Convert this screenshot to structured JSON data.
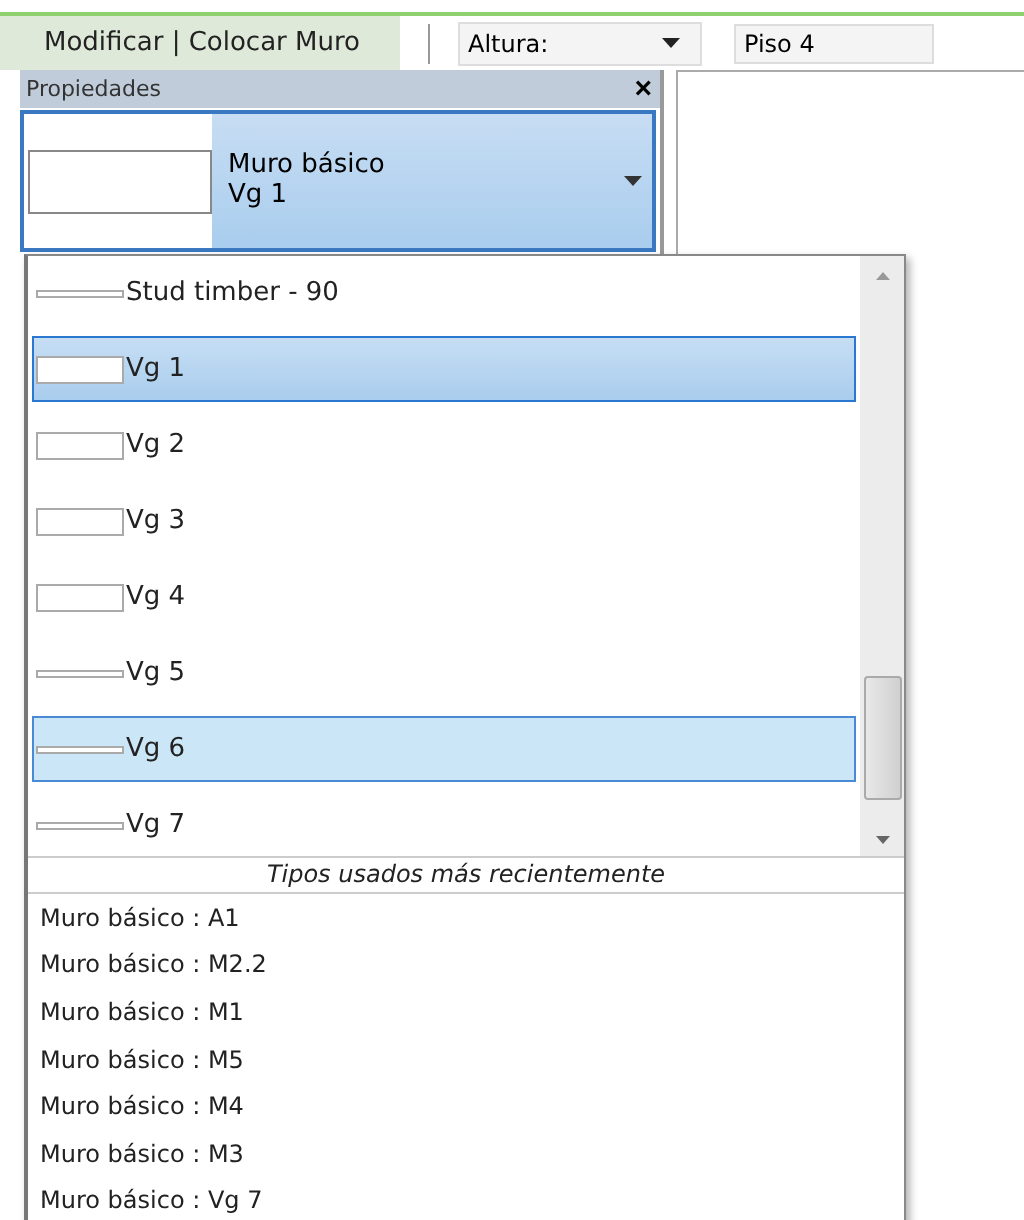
{
  "ribbon": {
    "context_label": "Modificar | Colocar Muro",
    "height_dropdown": {
      "label": "Altura:"
    },
    "level_field": {
      "value": "Piso 4"
    }
  },
  "properties": {
    "title": "Propiedades",
    "close": "×",
    "type_selector": {
      "family": "Muro básico",
      "type": "Vg 1"
    }
  },
  "type_list": {
    "items": [
      {
        "label": "Stud timber - 90",
        "kind": "thin",
        "selected": false,
        "hovered": false
      },
      {
        "label": "Vg 1",
        "kind": "thick",
        "selected": true,
        "hovered": false
      },
      {
        "label": "Vg 2",
        "kind": "thick",
        "selected": false,
        "hovered": false
      },
      {
        "label": "Vg 3",
        "kind": "thick",
        "selected": false,
        "hovered": false
      },
      {
        "label": "Vg 4",
        "kind": "thick",
        "selected": false,
        "hovered": false
      },
      {
        "label": "Vg 5",
        "kind": "thin",
        "selected": false,
        "hovered": false
      },
      {
        "label": "Vg 6",
        "kind": "thin",
        "selected": false,
        "hovered": true
      },
      {
        "label": "Vg 7",
        "kind": "thin",
        "selected": false,
        "hovered": false
      }
    ],
    "recent_header": "Tipos usados más recientemente",
    "recent": [
      "Muro básico : A1",
      "Muro básico : M2.2",
      "Muro básico : M1",
      "Muro básico : M5",
      "Muro básico : M4",
      "Muro básico : M3",
      "Muro básico : Vg 7"
    ]
  }
}
